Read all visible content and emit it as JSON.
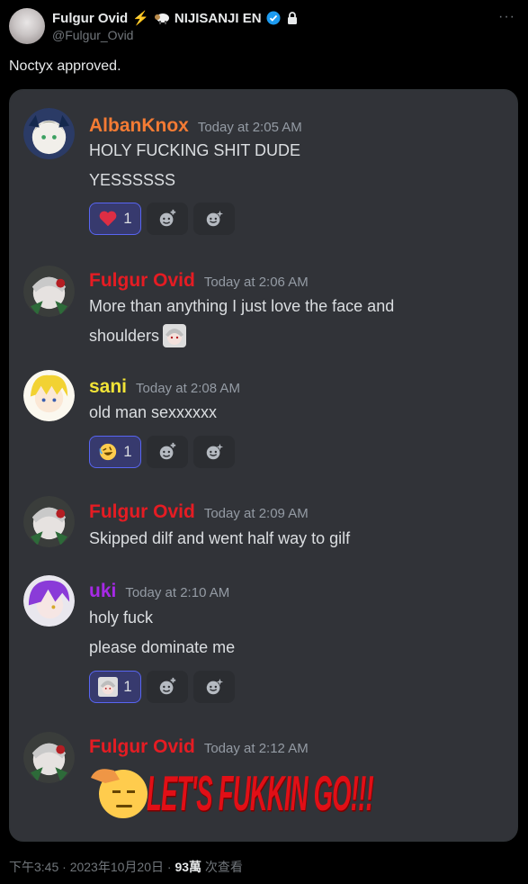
{
  "tweet": {
    "author_name": "Fulgur Ovid",
    "author_suffix": "NIJISANJI EN",
    "handle": "@Fulgur_Ovid",
    "more_icon": "more-dots-icon",
    "text": "Noctyx approved.",
    "footer": {
      "time": "下午3:45",
      "sep1": " · ",
      "date": "2023年10月20日",
      "sep2": " · ",
      "views": "93萬",
      "views_label": " 次查看"
    }
  },
  "discord": {
    "messages": [
      {
        "name": "AlbanKnox",
        "name_color": "#f47b34",
        "time": "Today at 2:05 AM",
        "lines": [
          "HOLY FUCKING SHIT DUDE",
          "YESSSSSS"
        ],
        "reaction": {
          "emoji": "heart",
          "count": "1"
        }
      },
      {
        "name": "Fulgur Ovid",
        "name_color": "#e51c23",
        "time": "Today at 2:06 AM",
        "lines": [
          "More than anything I just love the face and",
          "shoulders"
        ]
      },
      {
        "name": "sani",
        "name_color": "#f1e337",
        "time": "Today at 2:08 AM",
        "lines": [
          "old man sexxxxxx"
        ],
        "reaction": {
          "emoji": "rofl",
          "count": "1"
        }
      },
      {
        "name": "Fulgur Ovid",
        "name_color": "#e51c23",
        "time": "Today at 2:09 AM",
        "lines": [
          "Skipped dilf and went half way to gilf"
        ]
      },
      {
        "name": "uki",
        "name_color": "#a629e6",
        "time": "Today at 2:10 AM",
        "lines": [
          "holy fuck",
          "please dominate me"
        ],
        "reaction": {
          "emoji": "fulgur-face",
          "count": "1"
        }
      },
      {
        "name": "Fulgur Ovid",
        "name_color": "#e51c23",
        "time": "Today at 2:12 AM",
        "sticker_text": "LET'S FUKKIN GO!!!"
      }
    ]
  }
}
